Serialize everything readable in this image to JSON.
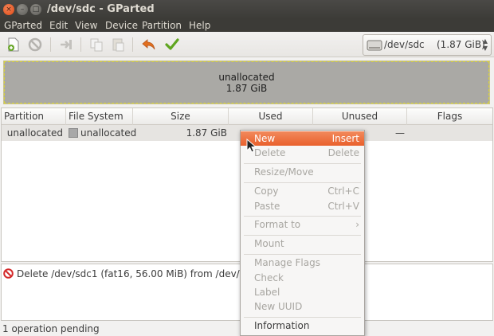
{
  "window": {
    "title": "/dev/sdc - GParted",
    "close_glyph": "×",
    "min_glyph": "–",
    "max_glyph": "□"
  },
  "menubar": {
    "items": [
      "GParted",
      "Edit",
      "View",
      "Device",
      "Partition",
      "Help"
    ]
  },
  "toolbar": {
    "icons": [
      "new-partition-icon",
      "delete-icon",
      "resize-move-icon",
      "copy-icon",
      "paste-icon",
      "undo-icon",
      "apply-icon"
    ],
    "device_name": "/dev/sdc",
    "device_size": "(1.87 GiB)"
  },
  "disk_map": {
    "label": "unallocated",
    "size": "1.87 GiB",
    "fill_color": "#aaa9a5",
    "border_color": "#d8d23a"
  },
  "table": {
    "columns": [
      "Partition",
      "File System",
      "Size",
      "Used",
      "Unused",
      "Flags"
    ],
    "rows": [
      {
        "partition": "unallocated",
        "file_system": "unallocated",
        "size": "1.87 GiB",
        "used": "",
        "unused": "—",
        "flags": ""
      }
    ]
  },
  "operations": {
    "items": [
      "Delete /dev/sdc1 (fat16, 56.00 MiB) from /dev/sdc"
    ]
  },
  "status": {
    "text": "1 operation pending"
  },
  "context_menu": {
    "items": [
      {
        "label": "New",
        "accel": "Insert",
        "state": "highlighted"
      },
      {
        "label": "Delete",
        "accel": "Delete",
        "state": "disabled"
      },
      {
        "label": "Resize/Move",
        "accel": "",
        "state": "disabled"
      },
      {
        "label": "Copy",
        "accel": "Ctrl+C",
        "state": "disabled"
      },
      {
        "label": "Paste",
        "accel": "Ctrl+V",
        "state": "disabled"
      },
      {
        "label": "Format to",
        "accel": "›",
        "state": "disabled"
      },
      {
        "label": "Mount",
        "accel": "",
        "state": "disabled"
      },
      {
        "label": "Manage Flags",
        "accel": "",
        "state": "disabled"
      },
      {
        "label": "Check",
        "accel": "",
        "state": "disabled"
      },
      {
        "label": "Label",
        "accel": "",
        "state": "disabled"
      },
      {
        "label": "New UUID",
        "accel": "",
        "state": "disabled"
      },
      {
        "label": "Information",
        "accel": "",
        "state": "enabled"
      }
    ]
  },
  "colors": {
    "accent": "#e9602c",
    "titlebar": "#3c3b37",
    "selection_row": "#e6e4e1"
  }
}
